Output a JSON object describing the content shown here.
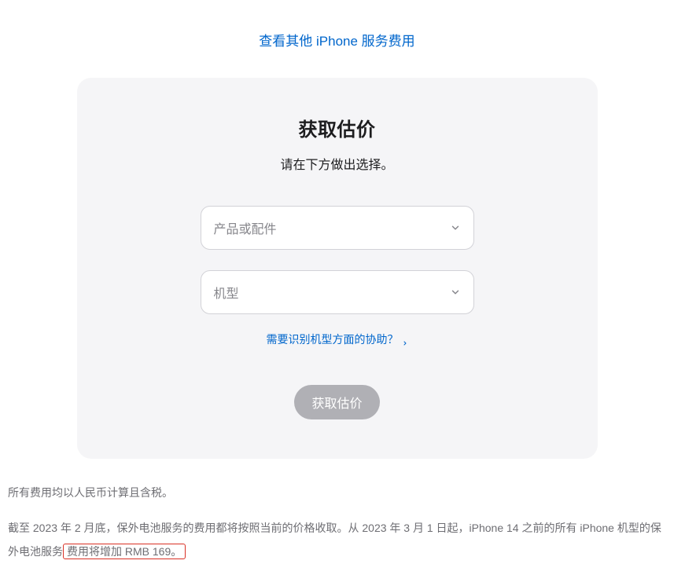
{
  "topLink": {
    "label": "查看其他 iPhone 服务费用"
  },
  "card": {
    "title": "获取估价",
    "subtitle": "请在下方做出选择。",
    "select1": {
      "placeholder": "产品或配件"
    },
    "select2": {
      "placeholder": "机型"
    },
    "helpLink": {
      "label": "需要识别机型方面的协助？"
    },
    "submitButton": {
      "label": "获取估价"
    }
  },
  "footer": {
    "para1": "所有费用均以人民币计算且含税。",
    "para2_part1": "截至 2023 年 2 月底，保外电池服务的费用都将按照当前的价格收取。从 2023 年 3 月 1 日起，iPhone 14 之前的所有 iPhone 机型的保外电池服务",
    "para2_highlight": "费用将增加 RMB 169。"
  }
}
